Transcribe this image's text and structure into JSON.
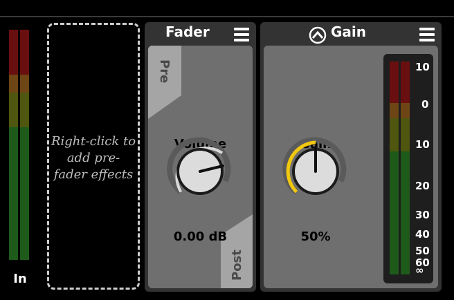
{
  "input_meter": {
    "label": "In"
  },
  "prefader_slot": {
    "text_lines": [
      "Right-click to",
      "add pre-",
      "fader effects"
    ]
  },
  "fader_panel": {
    "title": "Fader",
    "pre_tab": "Pre",
    "post_tab": "Post",
    "knob_label": "Volume",
    "value": "0.00 dB"
  },
  "gain_panel": {
    "title": "Gain",
    "knob_label": "Gain",
    "value": "50%",
    "meter_scale": [
      "10",
      "0",
      "10",
      "20",
      "30",
      "40",
      "50",
      "60",
      "∞"
    ]
  },
  "colors": {
    "background": "#000000",
    "panel": "#333333",
    "panel_body": "#6f6f6f",
    "accent_yellow": "#f2c80f",
    "meter_red": "#6a0f0f",
    "meter_orange": "#6e4515",
    "meter_yellow": "#4e560f",
    "meter_green": "#1e5a1a"
  },
  "icons": {
    "menu": "hamburger-menu-icon",
    "gain_logo": "gain-plugin-logo-icon"
  }
}
